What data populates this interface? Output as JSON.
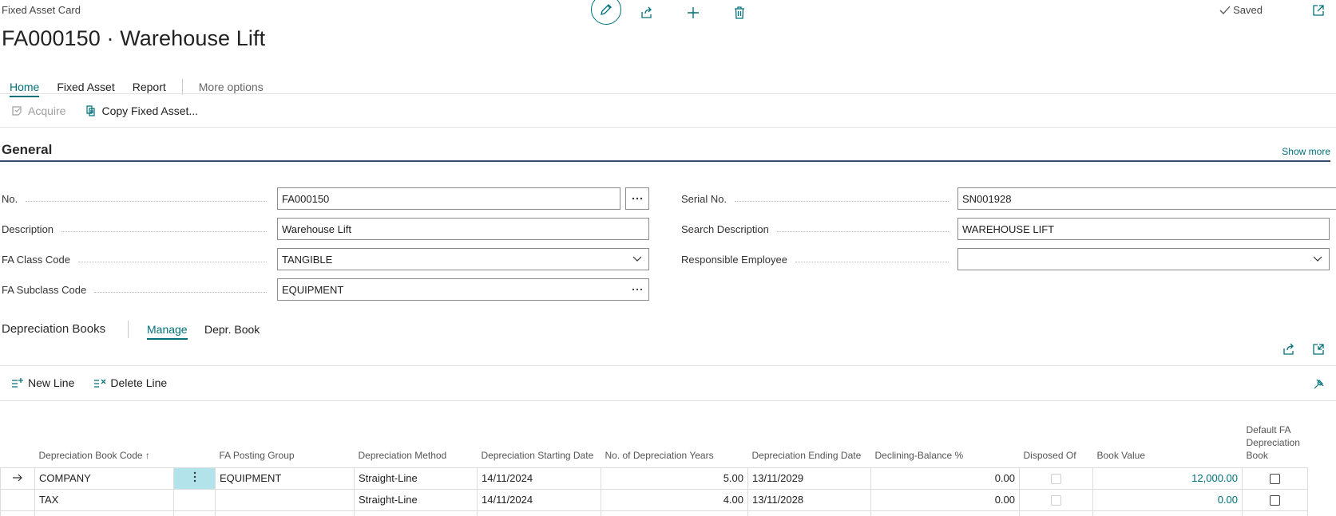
{
  "header": {
    "caption": "Fixed Asset Card",
    "title": "FA000150 · Warehouse Lift",
    "saved_label": "Saved",
    "icons": [
      "edit-icon",
      "share-icon",
      "new-icon",
      "delete-icon",
      "popout-icon"
    ]
  },
  "tabs": [
    {
      "label": "Home",
      "active": true
    },
    {
      "label": "Fixed Asset"
    },
    {
      "label": "Report"
    },
    {
      "label": "More options"
    }
  ],
  "actions": {
    "acquire": "Acquire",
    "copy_fixed_asset": "Copy Fixed Asset..."
  },
  "general": {
    "title": "General",
    "show_more": "Show more",
    "no": {
      "label": "No.",
      "value": "FA000150"
    },
    "description": {
      "label": "Description",
      "value": "Warehouse Lift"
    },
    "fa_class_code": {
      "label": "FA Class Code",
      "value": "TANGIBLE"
    },
    "fa_subclass_code": {
      "label": "FA Subclass Code",
      "value": "EQUIPMENT"
    },
    "serial_no": {
      "label": "Serial No.",
      "value": "SN001928"
    },
    "search_description": {
      "label": "Search Description",
      "value": "WAREHOUSE LIFT"
    },
    "responsible_employee": {
      "label": "Responsible Employee",
      "value": ""
    }
  },
  "depreciation": {
    "title": "Depreciation Books",
    "tabs": {
      "manage": "Manage",
      "depr_book": "Depr. Book"
    },
    "new_line": "New Line",
    "delete_line": "Delete Line",
    "columns": {
      "code": "Depreciation Book Code ↑",
      "posting_group": "FA Posting Group",
      "method": "Depreciation Method",
      "start": "Depreciation Starting Date",
      "years": "No. of Depreciation Years",
      "end": "Depreciation Ending Date",
      "declining": "Declining-Balance %",
      "disposed": "Disposed Of",
      "book_value": "Book Value",
      "default": "Default FA Depreciation Book"
    },
    "rows": [
      {
        "code": "COMPANY",
        "posting_group": "EQUIPMENT",
        "method": "Straight-Line",
        "start": "14/11/2024",
        "years": "5.00",
        "end": "13/11/2029",
        "declining": "0.00",
        "book_value": "12,000.00"
      },
      {
        "code": "TAX",
        "posting_group": "",
        "method": "Straight-Line",
        "start": "14/11/2024",
        "years": "4.00",
        "end": "13/11/2028",
        "declining": "0.00",
        "book_value": "0.00"
      }
    ]
  },
  "colors": {
    "accent": "#00707a",
    "selected_cell": "#b3e3ea",
    "section_rule": "#3a4b6a"
  }
}
